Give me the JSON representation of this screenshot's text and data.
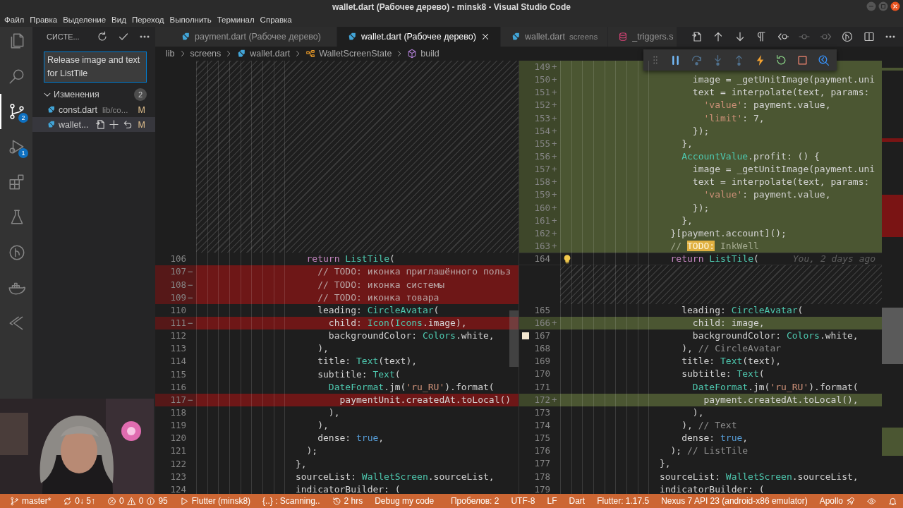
{
  "window": {
    "title": "wallet.dart (Рабочее дерево) - minsk8 - Visual Studio Code"
  },
  "menu": [
    "Файл",
    "Правка",
    "Выделение",
    "Вид",
    "Переход",
    "Выполнить",
    "Терминал",
    "Справка"
  ],
  "activity_bar": {
    "items": [
      {
        "selected": false
      },
      {
        "selected": false
      },
      {
        "selected": true,
        "badge": "2"
      },
      {
        "selected": false,
        "badge": "1"
      },
      {
        "selected": false
      },
      {
        "selected": false
      },
      {
        "selected": false
      },
      {
        "selected": false
      },
      {
        "selected": false
      }
    ]
  },
  "sidebar": {
    "title": "СИСТЕ...",
    "commit_message": "Release image and text for ListTile",
    "changes": {
      "title": "Изменения",
      "count": "2",
      "expanded": true,
      "files": [
        {
          "name": "const.dart",
          "path": "lib/co...",
          "status": "M",
          "selected": false
        },
        {
          "name": "wallet...",
          "status": "M",
          "selected": true
        }
      ]
    }
  },
  "editor": {
    "tabs": [
      {
        "kind": "dart",
        "title": "payment.dart (Рабочее дерево)",
        "selected": false
      },
      {
        "kind": "dart",
        "title": "wallet.dart (Рабочее дерево)",
        "selected": true
      },
      {
        "kind": "dart",
        "title": "wallet.dart",
        "description": "screens",
        "selected": false
      },
      {
        "kind": "database",
        "title": "_triggers.s",
        "selected": false
      }
    ],
    "actions": [
      {
        "disabled": false
      },
      {
        "disabled": false
      },
      {
        "disabled": false
      },
      {
        "disabled": false
      },
      {
        "disabled": false
      },
      {
        "disabled": true
      },
      {
        "disabled": true
      },
      {
        "disabled": false
      },
      {
        "disabled": false
      },
      {
        "disabled": false
      }
    ],
    "breadcrumbs": [
      {
        "kind": "folder",
        "label": "lib"
      },
      {
        "kind": "folder",
        "label": "screens"
      },
      {
        "kind": "dart",
        "label": "wallet.dart"
      },
      {
        "kind": "class",
        "label": "WalletScreenState"
      },
      {
        "kind": "method",
        "label": "build"
      }
    ],
    "diff": {
      "left": {
        "lines": [
          {
            "kind": "filler"
          },
          {
            "kind": "filler"
          },
          {
            "kind": "filler"
          },
          {
            "kind": "filler"
          },
          {
            "kind": "filler"
          },
          {
            "kind": "filler"
          },
          {
            "kind": "filler"
          },
          {
            "kind": "filler"
          },
          {
            "kind": "filler"
          },
          {
            "kind": "filler"
          },
          {
            "kind": "filler"
          },
          {
            "kind": "filler"
          },
          {
            "kind": "filler"
          },
          {
            "kind": "filler"
          },
          {
            "kind": "filler"
          },
          {
            "kind": "normal",
            "number": "106",
            "code": [
              {
                "kind": "k",
                "text": "                    return"
              },
              {
                "kind": "t",
                "text": " ListTile"
              },
              {
                "kind": "p",
                "text": "("
              }
            ]
          },
          {
            "kind": "removed",
            "number": "107",
            "sign": "−",
            "code": [
              {
                "kind": "c",
                "text": "                      // TODO: иконка приглашённого польз"
              }
            ]
          },
          {
            "kind": "removed",
            "number": "108",
            "sign": "−",
            "code": [
              {
                "kind": "c",
                "text": "                      // TODO: иконка системы"
              }
            ]
          },
          {
            "kind": "removed",
            "number": "109",
            "sign": "−",
            "code": [
              {
                "kind": "c",
                "text": "                      // TODO: иконка товара"
              }
            ]
          },
          {
            "kind": "normal",
            "number": "110",
            "code": [
              {
                "kind": "p",
                "text": "                      leading: "
              },
              {
                "kind": "t",
                "text": "CircleAvatar"
              },
              {
                "kind": "p",
                "text": "("
              }
            ]
          },
          {
            "kind": "removed",
            "number": "111",
            "sign": "−",
            "code": [
              {
                "kind": "p",
                "text": "                        child: "
              },
              {
                "kind": "t",
                "text": "Icon"
              },
              {
                "kind": "p",
                "text": "("
              },
              {
                "kind": "t",
                "text": "Icons"
              },
              {
                "kind": "p",
                "text": ".image),"
              }
            ]
          },
          {
            "kind": "normal",
            "number": "112",
            "code": [
              {
                "kind": "p",
                "text": "                        backgroundColor: "
              },
              {
                "kind": "t",
                "text": "Colors"
              },
              {
                "kind": "p",
                "text": ".white,"
              }
            ]
          },
          {
            "kind": "normal",
            "number": "113",
            "code": [
              {
                "kind": "p",
                "text": "                      ),"
              }
            ]
          },
          {
            "kind": "normal",
            "number": "114",
            "code": [
              {
                "kind": "p",
                "text": "                      title: "
              },
              {
                "kind": "t",
                "text": "Text"
              },
              {
                "kind": "p",
                "text": "(text),"
              }
            ]
          },
          {
            "kind": "normal",
            "number": "115",
            "code": [
              {
                "kind": "p",
                "text": "                      subtitle: "
              },
              {
                "kind": "t",
                "text": "Text"
              },
              {
                "kind": "p",
                "text": "("
              }
            ]
          },
          {
            "kind": "normal",
            "number": "116",
            "code": [
              {
                "kind": "t",
                "text": "                        DateFormat"
              },
              {
                "kind": "p",
                "text": ".jm("
              },
              {
                "kind": "s",
                "text": "'ru_RU'"
              },
              {
                "kind": "p",
                "text": ").format("
              }
            ]
          },
          {
            "kind": "removed",
            "number": "117",
            "sign": "−",
            "code": [
              {
                "kind": "p",
                "text": "                          paymentUnit.createdAt.toLocal()"
              }
            ]
          },
          {
            "kind": "normal",
            "number": "118",
            "code": [
              {
                "kind": "p",
                "text": "                        ),"
              }
            ]
          },
          {
            "kind": "normal",
            "number": "119",
            "code": [
              {
                "kind": "p",
                "text": "                      ),"
              }
            ]
          },
          {
            "kind": "normal",
            "number": "120",
            "code": [
              {
                "kind": "p",
                "text": "                      dense: "
              },
              {
                "kind": "b",
                "text": "true"
              },
              {
                "kind": "p",
                "text": ","
              }
            ]
          },
          {
            "kind": "normal",
            "number": "121",
            "code": [
              {
                "kind": "p",
                "text": "                    );"
              }
            ]
          },
          {
            "kind": "normal",
            "number": "122",
            "code": [
              {
                "kind": "p",
                "text": "                  },"
              }
            ]
          },
          {
            "kind": "normal",
            "number": "123",
            "code": [
              {
                "kind": "p",
                "text": "                  sourceList: "
              },
              {
                "kind": "t",
                "text": "WalletScreen"
              },
              {
                "kind": "p",
                "text": ".sourceList,"
              }
            ]
          },
          {
            "kind": "normal",
            "number": "124",
            "code": [
              {
                "kind": "p",
                "text": "                  indicatorBuilder: ("
              }
            ]
          }
        ]
      },
      "right": {
        "lines": [
          {
            "kind": "added",
            "number": "149",
            "sign": "+"
          },
          {
            "kind": "added",
            "number": "150",
            "sign": "+",
            "code": [
              {
                "kind": "p",
                "text": "                        image = _getUnitImage(payment.uni"
              }
            ]
          },
          {
            "kind": "added",
            "number": "151",
            "sign": "+",
            "code": [
              {
                "kind": "p",
                "text": "                        text = interpolate(text, params:"
              }
            ]
          },
          {
            "kind": "added",
            "number": "152",
            "sign": "+",
            "code": [
              {
                "kind": "s",
                "text": "                          'value'"
              },
              {
                "kind": "p",
                "text": ": payment.value,"
              }
            ]
          },
          {
            "kind": "added",
            "number": "153",
            "sign": "+",
            "code": [
              {
                "kind": "s",
                "text": "                          'limit'"
              },
              {
                "kind": "p",
                "text": ": 7,"
              }
            ]
          },
          {
            "kind": "added",
            "number": "154",
            "sign": "+",
            "code": [
              {
                "kind": "p",
                "text": "                        });"
              }
            ]
          },
          {
            "kind": "added",
            "number": "155",
            "sign": "+",
            "code": [
              {
                "kind": "p",
                "text": "                      },"
              }
            ]
          },
          {
            "kind": "added",
            "number": "156",
            "sign": "+",
            "code": [
              {
                "kind": "t",
                "text": "                      AccountValue"
              },
              {
                "kind": "p",
                "text": ".profit: () {"
              }
            ]
          },
          {
            "kind": "added",
            "number": "157",
            "sign": "+",
            "code": [
              {
                "kind": "p",
                "text": "                        image = _getUnitImage(payment.uni"
              }
            ]
          },
          {
            "kind": "added",
            "number": "158",
            "sign": "+",
            "code": [
              {
                "kind": "p",
                "text": "                        text = interpolate(text, params:"
              }
            ]
          },
          {
            "kind": "added",
            "number": "159",
            "sign": "+",
            "code": [
              {
                "kind": "s",
                "text": "                          'value'"
              },
              {
                "kind": "p",
                "text": ": payment.value,"
              }
            ]
          },
          {
            "kind": "added",
            "number": "160",
            "sign": "+",
            "code": [
              {
                "kind": "p",
                "text": "                        });"
              }
            ]
          },
          {
            "kind": "added",
            "number": "161",
            "sign": "+",
            "code": [
              {
                "kind": "p",
                "text": "                      },"
              }
            ]
          },
          {
            "kind": "added",
            "number": "162",
            "sign": "+",
            "code": [
              {
                "kind": "p",
                "text": "                    }[payment.account]();"
              }
            ]
          },
          {
            "kind": "added",
            "number": "163",
            "sign": "+",
            "code": [
              {
                "kind": "c",
                "text": "                    // "
              },
              {
                "kind": "todo",
                "text": "TODO:"
              },
              {
                "kind": "c",
                "text": " InkWell"
              }
            ]
          },
          {
            "kind": "normal",
            "number": "164",
            "cursor": true,
            "lightbulb": true,
            "code": [
              {
                "kind": "k",
                "text": "                    return"
              },
              {
                "kind": "t",
                "text": " ListTile"
              },
              {
                "kind": "p",
                "text": "("
              }
            ],
            "blame": "You, 2 days ago"
          },
          {
            "kind": "filler"
          },
          {
            "kind": "filler"
          },
          {
            "kind": "filler"
          },
          {
            "kind": "normal",
            "number": "165",
            "code": [
              {
                "kind": "p",
                "text": "                      leading: "
              },
              {
                "kind": "t",
                "text": "CircleAvatar"
              },
              {
                "kind": "p",
                "text": "("
              }
            ]
          },
          {
            "kind": "added",
            "number": "166",
            "sign": "+",
            "code": [
              {
                "kind": "p",
                "text": "                        child: image,"
              }
            ]
          },
          {
            "kind": "normal",
            "number": "167",
            "bookmarked": true,
            "code": [
              {
                "kind": "p",
                "text": "                        backgroundColor: "
              },
              {
                "kind": "t",
                "text": "Colors"
              },
              {
                "kind": "p",
                "text": ".white,"
              }
            ]
          },
          {
            "kind": "normal",
            "number": "168",
            "code": [
              {
                "kind": "p",
                "text": "                      ), "
              },
              {
                "kind": "c",
                "text": "// CircleAvatar"
              }
            ]
          },
          {
            "kind": "normal",
            "number": "169",
            "code": [
              {
                "kind": "p",
                "text": "                      title: "
              },
              {
                "kind": "t",
                "text": "Text"
              },
              {
                "kind": "p",
                "text": "(text),"
              }
            ]
          },
          {
            "kind": "normal",
            "number": "170",
            "code": [
              {
                "kind": "p",
                "text": "                      subtitle: "
              },
              {
                "kind": "t",
                "text": "Text"
              },
              {
                "kind": "p",
                "text": "("
              }
            ]
          },
          {
            "kind": "normal",
            "number": "171",
            "code": [
              {
                "kind": "t",
                "text": "                        DateFormat"
              },
              {
                "kind": "p",
                "text": ".jm("
              },
              {
                "kind": "s",
                "text": "'ru_RU'"
              },
              {
                "kind": "p",
                "text": ").format("
              }
            ]
          },
          {
            "kind": "added",
            "number": "172",
            "sign": "+",
            "code": [
              {
                "kind": "p",
                "text": "                          payment.createdAt.toLocal(),"
              }
            ]
          },
          {
            "kind": "normal",
            "number": "173",
            "code": [
              {
                "kind": "p",
                "text": "                        ),"
              }
            ]
          },
          {
            "kind": "normal",
            "number": "174",
            "code": [
              {
                "kind": "p",
                "text": "                      ), "
              },
              {
                "kind": "c",
                "text": "// Text"
              }
            ]
          },
          {
            "kind": "normal",
            "number": "175",
            "code": [
              {
                "kind": "p",
                "text": "                      dense: "
              },
              {
                "kind": "b",
                "text": "true"
              },
              {
                "kind": "p",
                "text": ","
              }
            ]
          },
          {
            "kind": "normal",
            "number": "176",
            "code": [
              {
                "kind": "p",
                "text": "                    ); "
              },
              {
                "kind": "c",
                "text": "// ListTile"
              }
            ]
          },
          {
            "kind": "normal",
            "number": "177",
            "code": [
              {
                "kind": "p",
                "text": "                  },"
              }
            ]
          },
          {
            "kind": "normal",
            "number": "178",
            "code": [
              {
                "kind": "p",
                "text": "                  sourceList: "
              },
              {
                "kind": "t",
                "text": "WalletScreen"
              },
              {
                "kind": "p",
                "text": ".sourceList,"
              }
            ]
          },
          {
            "kind": "normal",
            "number": "179",
            "code": [
              {
                "kind": "p",
                "text": "                  indicatorBuilder: ("
              }
            ]
          }
        ]
      }
    }
  },
  "debug_toolbar": {
    "buttons": [
      {
        "disabled": false
      },
      {
        "disabled": true
      },
      {
        "disabled": true
      },
      {
        "disabled": true
      },
      {
        "disabled": false
      },
      {
        "disabled": false
      },
      {
        "disabled": false
      },
      {
        "disabled": false
      }
    ]
  },
  "status_bar": {
    "left": [
      {
        "kind": "branch",
        "text": "master*"
      },
      {
        "kind": "sync",
        "text": "0↓ 5↑"
      },
      {
        "kind": "problems",
        "errors": "0",
        "warnings": "0",
        "infos": "95"
      },
      {
        "kind": "run",
        "text": "Flutter (minsk8)"
      },
      {
        "kind": "plain",
        "text": "{..} : Scanning.."
      },
      {
        "kind": "history",
        "text": "2 hrs"
      },
      {
        "kind": "plain",
        "text": "Debug my code"
      }
    ],
    "right": [
      {
        "kind": "plain",
        "text": "Пробелов: 2"
      },
      {
        "kind": "plain",
        "text": "UTF-8"
      },
      {
        "kind": "plain",
        "text": "LF"
      },
      {
        "kind": "plain",
        "text": "Dart"
      },
      {
        "kind": "plain",
        "text": "Flutter: 1.17.5"
      },
      {
        "kind": "plain",
        "text": "Nexus 7 API 23 (android-x86 emulator)"
      },
      {
        "kind": "rocket",
        "text": "Apollo"
      },
      {
        "kind": "eye"
      },
      {
        "kind": "bell"
      }
    ]
  }
}
